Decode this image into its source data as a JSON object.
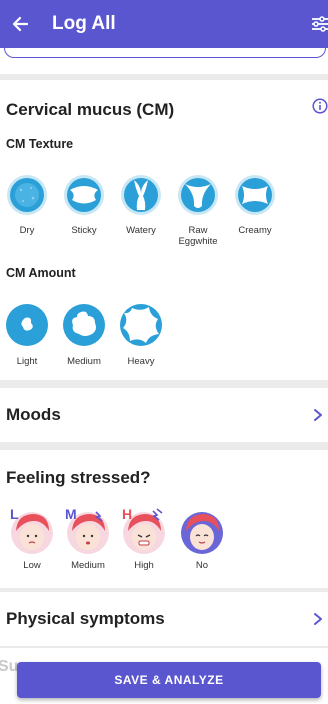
{
  "header": {
    "title": "Log All",
    "back_icon": "arrow-left-icon",
    "menu_icon": "sliders-icon",
    "bg_color": "#5a56cf"
  },
  "cm": {
    "title": "Cervical mucus (CM)",
    "texture_label": "CM Texture",
    "textures": [
      {
        "label": "Dry",
        "icon": "cm-dry-icon"
      },
      {
        "label": "Sticky",
        "icon": "cm-sticky-icon"
      },
      {
        "label": "Watery",
        "icon": "cm-watery-icon"
      },
      {
        "label": "Raw\nEggwhite",
        "icon": "cm-raw-eggwhite-icon"
      },
      {
        "label": "Creamy",
        "icon": "cm-creamy-icon"
      }
    ],
    "amount_label": "CM Amount",
    "amounts": [
      {
        "label": "Light",
        "icon": "cm-light-icon"
      },
      {
        "label": "Medium",
        "icon": "cm-medium-icon"
      },
      {
        "label": "Heavy",
        "icon": "cm-heavy-icon"
      }
    ]
  },
  "moods": {
    "title": "Moods"
  },
  "stress": {
    "title": "Feeling stressed?",
    "options": [
      {
        "label": "Low",
        "badge": "L"
      },
      {
        "label": "Medium",
        "badge": "M"
      },
      {
        "label": "High",
        "badge": "H"
      },
      {
        "label": "No",
        "badge": ""
      }
    ]
  },
  "physical": {
    "title": "Physical symptoms"
  },
  "next_section_peek": "Su",
  "save_button": {
    "label": "SAVE & ANALYZE"
  },
  "colors": {
    "accent": "#5a56cf",
    "cm_blue": "#2a9fd8",
    "face_red": "#e8505b"
  }
}
